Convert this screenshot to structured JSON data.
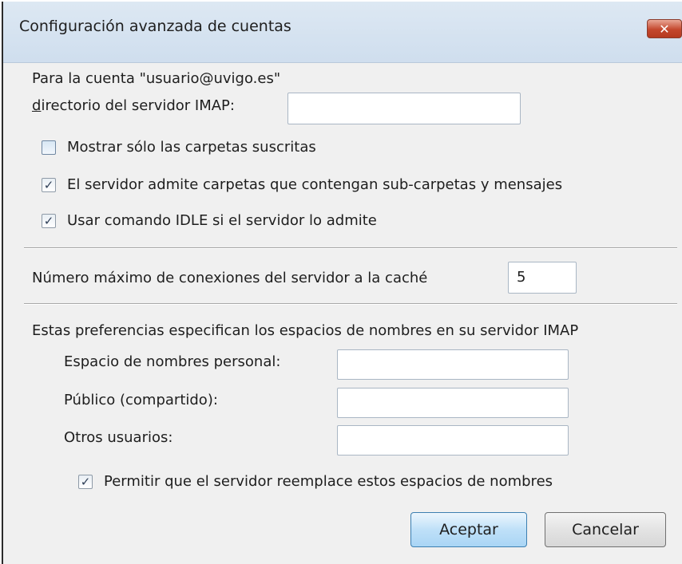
{
  "dialog": {
    "title": "Configuración avanzada de cuentas",
    "close_label": "✕"
  },
  "account": {
    "label": "Para la cuenta \"usuario@uvigo.es\"",
    "imap_dir_label": "directorio del servidor IMAP:",
    "imap_dir_value": ""
  },
  "options": {
    "subscribed_only": {
      "label": "Mostrar sólo las carpetas suscritas",
      "checked": false
    },
    "subfolders_and_messages": {
      "label": "El servidor admite carpetas que contengan sub-carpetas y mensajes",
      "checked": true
    },
    "idle": {
      "label": "Usar comando IDLE si el servidor lo admite",
      "checked": true
    }
  },
  "cache": {
    "label": "Número máximo de conexiones del servidor a la caché",
    "value": "5"
  },
  "namespaces": {
    "intro": "Estas preferencias especifican los espacios de nombres en su servidor IMAP",
    "personal_label": "Espacio de nombres personal:",
    "personal_value": "",
    "public_label": "Público (compartido):",
    "public_value": "",
    "others_label": "Otros usuarios:",
    "others_value": "",
    "allow_override": {
      "label": "Permitir que el servidor reemplace estos espacios de nombres",
      "checked": true
    }
  },
  "buttons": {
    "accept": "Aceptar",
    "cancel": "Cancelar"
  },
  "icons": {
    "close": "close-icon",
    "checkbox_check": "check-icon"
  }
}
